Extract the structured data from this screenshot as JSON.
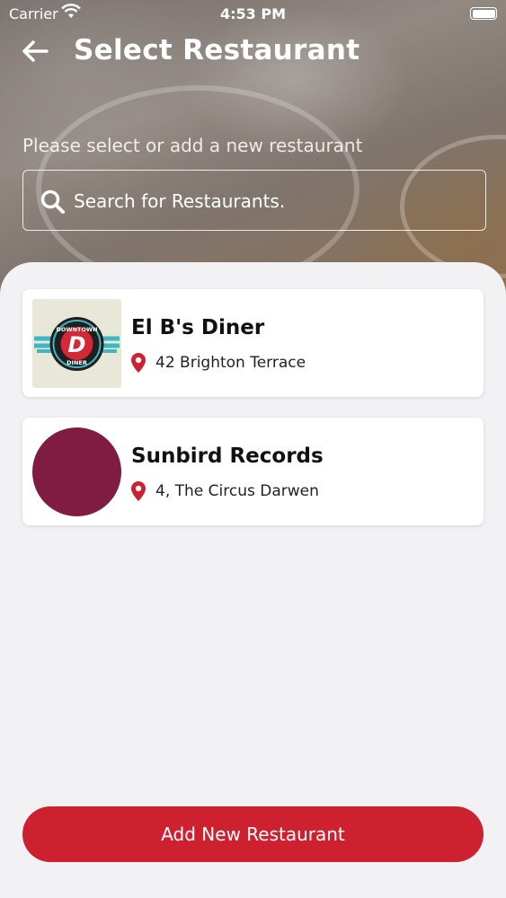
{
  "status_bar": {
    "carrier": "Carrier",
    "time": "4:53 PM"
  },
  "header": {
    "title": "Select Restaurant",
    "back_icon": "arrow-left-icon"
  },
  "search": {
    "subtitle": "Please select or add a new restaurant",
    "placeholder": "Search for Restaurants.",
    "icon": "search-icon"
  },
  "restaurants": [
    {
      "name": "El B's Diner",
      "address": "42 Brighton Terrace",
      "thumbnail": "downtown-diner-logo",
      "logo_text_top": "DOWNTOWN",
      "logo_letter": "D",
      "logo_text_bottom": "DINER"
    },
    {
      "name": "Sunbird Records",
      "address": "4, The Circus Darwen",
      "thumbnail": "color-circle",
      "thumbnail_color": "#801b42"
    }
  ],
  "add_button": {
    "label": "Add New Restaurant"
  },
  "colors": {
    "accent": "#cd2130",
    "pin": "#cd2130",
    "panel_bg": "#f2f2f4"
  }
}
